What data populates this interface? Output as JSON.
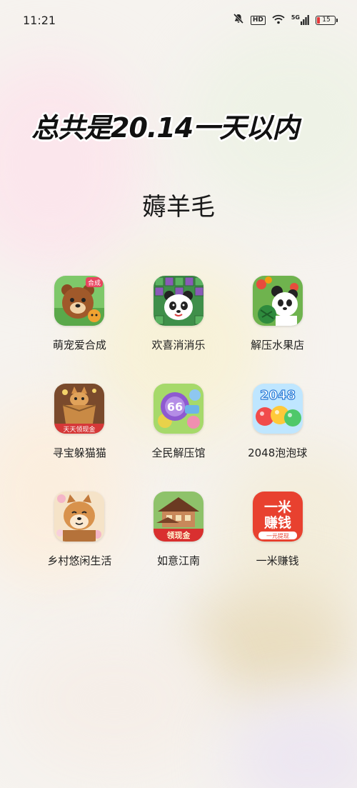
{
  "status_bar": {
    "time": "11:21",
    "network": "5G",
    "hd": "HD",
    "battery_level": "15",
    "battery_color": "#e5393a"
  },
  "caption": "总共是20.14一天以内",
  "folder": {
    "title": "薅羊毛",
    "apps": [
      {
        "label": "萌宠爱合成",
        "icon": "bear-icon",
        "badge": "合成"
      },
      {
        "label": "欢喜消消乐",
        "icon": "panda-blocks-icon"
      },
      {
        "label": "解压水果店",
        "icon": "panda-fruit-icon"
      },
      {
        "label": "寻宝躲猫猫",
        "icon": "cat-box-icon",
        "badge": "天天领现金"
      },
      {
        "label": "全民解压馆",
        "icon": "bubble-66-icon",
        "badge": "66"
      },
      {
        "label": "2048泡泡球",
        "icon": "bubble-balls-icon",
        "badge": "2048"
      },
      {
        "label": "乡村悠闲生活",
        "icon": "dog-icon"
      },
      {
        "label": "如意江南",
        "icon": "house-icon",
        "badge": "领现金"
      },
      {
        "label": "一米赚钱",
        "icon": "coin-text-icon",
        "badge": "一米\n赚钱",
        "sub": "一元提现",
        "badge_line1": "一米",
        "badge_line2": "赚钱"
      }
    ]
  }
}
